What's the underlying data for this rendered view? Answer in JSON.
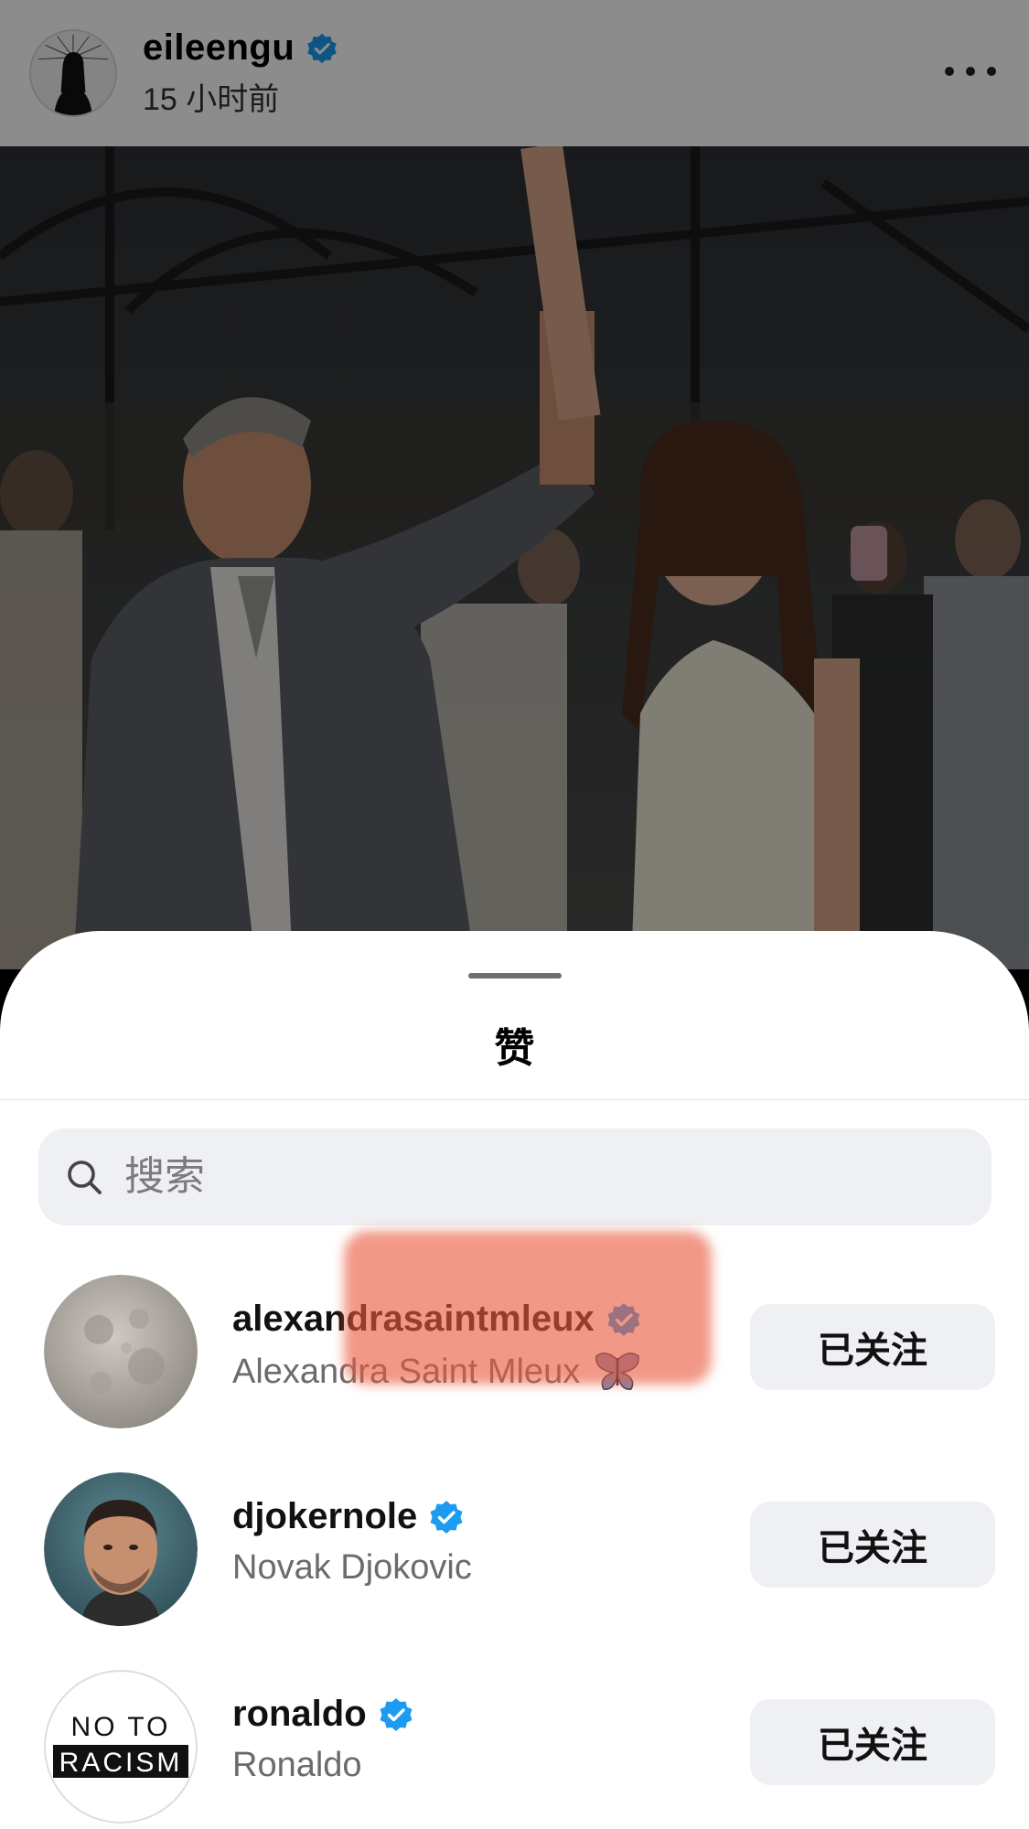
{
  "header": {
    "username": "eileengu",
    "time": "15 小时前",
    "verified": true
  },
  "sheet": {
    "title": "赞",
    "search_placeholder": "搜索"
  },
  "likes": [
    {
      "username": "alexandrasaintmleux",
      "fullname": "Alexandra Saint Mleux",
      "verified": true,
      "emoji": "butterfly",
      "button": "已关注"
    },
    {
      "username": "djokernole",
      "fullname": "Novak Djokovic",
      "verified": true,
      "button": "已关注"
    },
    {
      "username": "ronaldo",
      "fullname": "Ronaldo",
      "verified": true,
      "button": "已关注",
      "avatar_text_line1": "NO TO",
      "avatar_text_line2": "RACISM"
    }
  ],
  "colors": {
    "verified_blue": "#1d9bf0",
    "highlight": "#ea583e",
    "button_bg": "#eff0f3"
  }
}
